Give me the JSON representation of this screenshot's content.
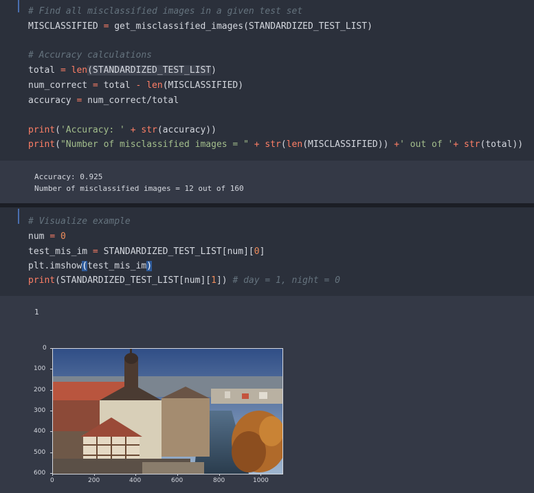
{
  "cell1": {
    "lines": [
      "# Find all misclassified images in a given test set",
      "MISCLASSIFIED = get_misclassified_images(STANDARDIZED_TEST_LIST)",
      "# Accuracy calculations",
      "total = len(STANDARDIZED_TEST_LIST)",
      "num_correct = total - len(MISCLASSIFIED)",
      "accuracy = num_correct/total",
      "print('Accuracy: ' + str(accuracy))",
      "print(\"Number of misclassified images = \" + str(len(MISCLASSIFIED)) +' out of '+ str(total))"
    ]
  },
  "output1": {
    "line1": "Accuracy: 0.925",
    "line2": "Number of misclassified images = 12 out of 160"
  },
  "cell2": {
    "lines": [
      "# Visualize example",
      "num = 0",
      "test_mis_im = STANDARDIZED_TEST_LIST[num][0]",
      "plt.imshow(test_mis_im)",
      "print(STANDARDIZED_TEST_LIST[num][1]) # day = 1, night = 0"
    ]
  },
  "output2": {
    "printed": "1",
    "y_ticks": [
      "0",
      "100",
      "200",
      "300",
      "400",
      "500",
      "600"
    ],
    "x_ticks": [
      "0",
      "200",
      "400",
      "600",
      "800",
      "1000"
    ],
    "image_description_icon": "town-photo"
  }
}
